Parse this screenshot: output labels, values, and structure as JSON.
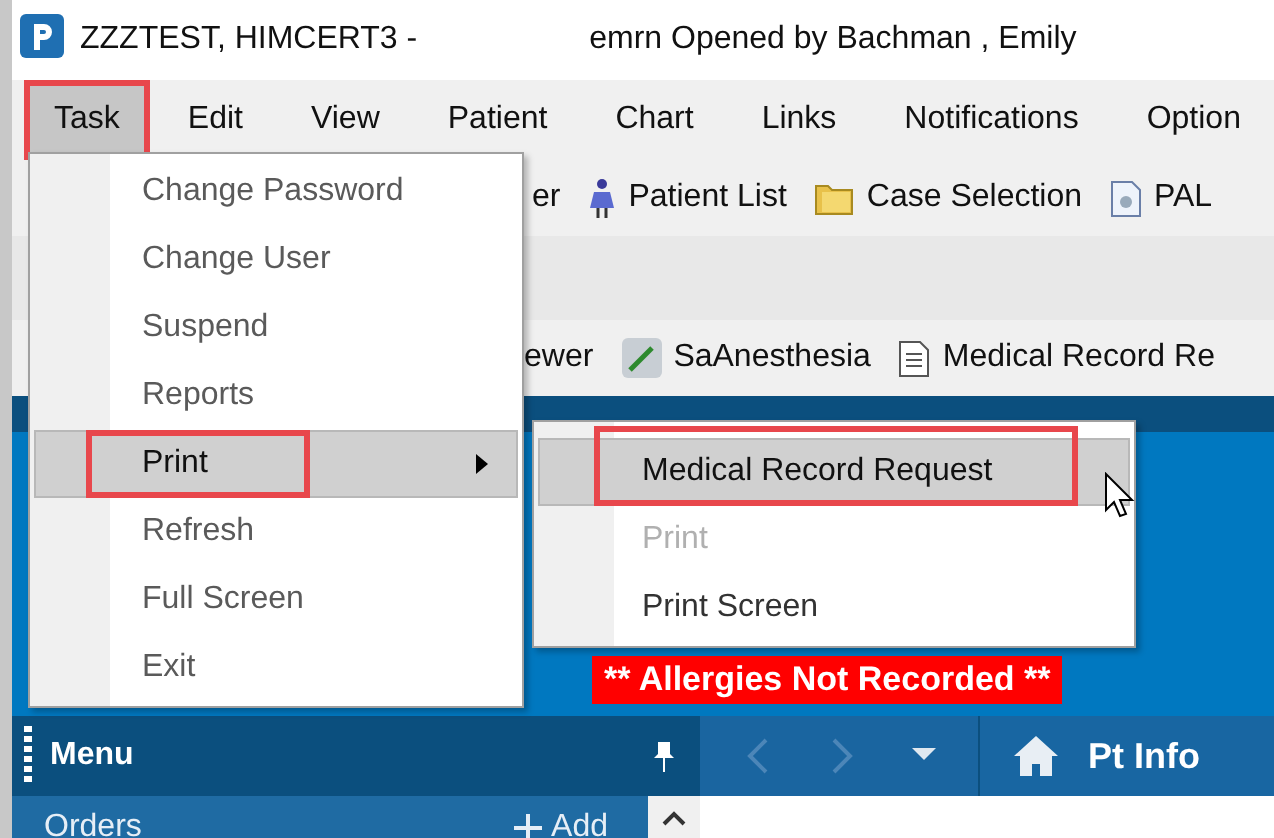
{
  "window": {
    "title": "ZZZTEST, HIMCERT3 -",
    "subtitle": "emrn Opened by Bachman , Emily"
  },
  "menubar": [
    {
      "label": "Task",
      "selected": true,
      "highlighted": true
    },
    {
      "label": "Edit",
      "selected": false,
      "highlighted": false
    },
    {
      "label": "View",
      "selected": false,
      "highlighted": false
    },
    {
      "label": "Patient",
      "selected": false,
      "highlighted": false
    },
    {
      "label": "Chart",
      "selected": false,
      "highlighted": false
    },
    {
      "label": "Links",
      "selected": false,
      "highlighted": false
    },
    {
      "label": "Notifications",
      "selected": false,
      "highlighted": false
    },
    {
      "label": "Option",
      "selected": false,
      "highlighted": false
    }
  ],
  "toolbar_1": [
    {
      "label": "er"
    },
    {
      "label": "Patient List"
    },
    {
      "label": "Case Selection"
    },
    {
      "label": "PAL"
    }
  ],
  "toolbar_2": [
    {
      "label": "ewer"
    },
    {
      "label": "SaAnesthesia"
    },
    {
      "label": "Medical Record Re"
    }
  ],
  "task_menu": [
    {
      "label": "Change Password",
      "selected": false,
      "submenu": false,
      "highlighted": false
    },
    {
      "label": "Change User",
      "selected": false,
      "submenu": false,
      "highlighted": false
    },
    {
      "label": "Suspend",
      "selected": false,
      "submenu": false,
      "highlighted": false
    },
    {
      "label": "Reports",
      "selected": false,
      "submenu": false,
      "highlighted": false
    },
    {
      "label": "Print",
      "selected": true,
      "submenu": true,
      "highlighted": true
    },
    {
      "label": "Refresh",
      "selected": false,
      "submenu": false,
      "highlighted": false
    },
    {
      "label": "Full Screen",
      "selected": false,
      "submenu": false,
      "highlighted": false
    },
    {
      "label": "Exit",
      "selected": false,
      "submenu": false,
      "highlighted": false
    }
  ],
  "print_submenu": [
    {
      "label": "Medical Record Request",
      "selected": true,
      "disabled": false,
      "highlighted": true
    },
    {
      "label": "Print",
      "selected": false,
      "disabled": true,
      "highlighted": false
    },
    {
      "label": "Print Screen",
      "selected": false,
      "disabled": false,
      "highlighted": false
    }
  ],
  "allergy_banner": "** Allergies Not Recorded **",
  "side_panel": {
    "title": "Menu",
    "section": "Orders",
    "add_label": "Add"
  },
  "nav": {
    "page_title": "Pt Info"
  }
}
